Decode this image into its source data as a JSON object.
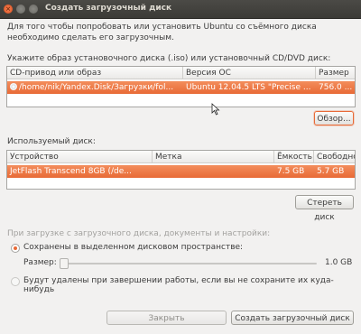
{
  "window": {
    "title": "Создать загрузочный диск"
  },
  "intro": {
    "line1": "Для того чтобы попробовать или установить Ubuntu со съёмного диска",
    "line2": "необходимо сделать его загрузочным."
  },
  "source": {
    "label": "Укажите образ установочного диска (.iso) или установочный CD/DVD диск:",
    "columns": [
      "CD-привод или образ",
      "Версия ОС",
      "Размер"
    ],
    "rows": [
      {
        "path": "/home/nik/Yandex.Disk/Загрузки/fol...",
        "version": "Ubuntu 12.04.5 LTS \"Precise ...",
        "size": "756.0 ..."
      }
    ],
    "browse_label": "Обзор..."
  },
  "target": {
    "label": "Используемый диск:",
    "columns": [
      "Устройство",
      "Метка",
      "Ёмкость",
      "Свободно"
    ],
    "rows": [
      {
        "device": "JetFlash Transcend 8GB (/de...",
        "label": "",
        "capacity": "7.5 GB",
        "free": "5.7 GB"
      }
    ],
    "erase_label": "Стереть диск"
  },
  "options": {
    "label": "При загрузке с загрузочного диска, документы и настройки:",
    "save_label": "Сохранены в выделенном дисковом пространстве:",
    "size_label": "Размер:",
    "size_value": "1.0 GB",
    "size_fraction": 0.0,
    "discard_label": "Будут удалены при завершении работы, если вы не сохраните их куда-нибудь"
  },
  "footer": {
    "close_label": "Закрыть",
    "create_label": "Создать загрузочный диск"
  },
  "colors": {
    "accent": "#e86a36"
  }
}
